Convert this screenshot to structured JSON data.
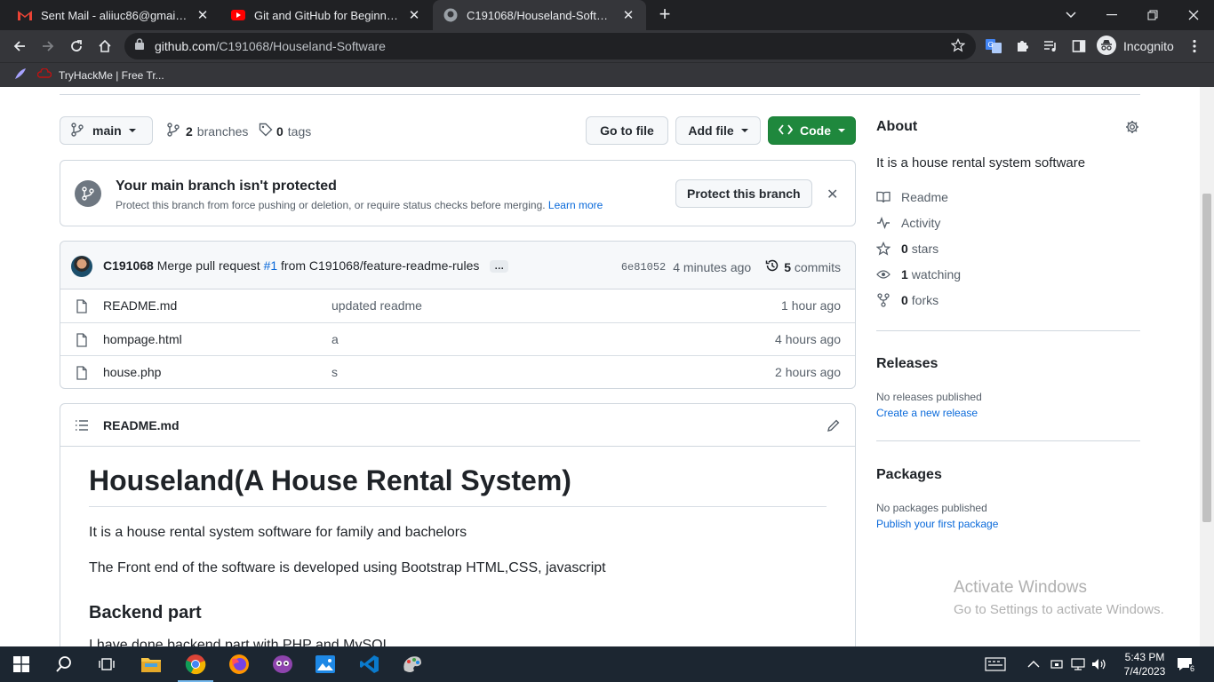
{
  "browser": {
    "tabs": [
      {
        "title": "Sent Mail - aliiuc86@gmail.com -",
        "icon": "gmail-icon"
      },
      {
        "title": "Git and GitHub for Beginners - Cr",
        "icon": "youtube-icon"
      },
      {
        "title": "C191068/Houseland-Software: It",
        "icon": "github-icon",
        "active": true
      }
    ],
    "url_host": "github.com",
    "url_path": "/C191068/Houseland-Software",
    "profile_label": "Incognito",
    "bookmark": "TryHackMe | Free Tr..."
  },
  "repo": {
    "branch": "main",
    "branches_count": "2",
    "branches_label": "branches",
    "tags_count": "0",
    "tags_label": "tags",
    "go_to_file": "Go to file",
    "add_file": "Add file",
    "code": "Code"
  },
  "protect": {
    "title": "Your main branch isn't protected",
    "desc": "Protect this branch from force pushing or deletion, or require status checks before merging.",
    "learn_more": "Learn more",
    "button": "Protect this branch"
  },
  "commit": {
    "author": "C191068",
    "message_pre": "Merge pull request",
    "pr": "#1",
    "message_post": "from C191068/feature-readme-rules",
    "more": "…",
    "sha": "6e81052",
    "time": "4 minutes ago",
    "count": "5",
    "count_label": "commits"
  },
  "files": [
    {
      "name": "README.md",
      "message": "updated readme",
      "age": "1 hour ago"
    },
    {
      "name": "hompage.html",
      "message": "a",
      "age": "4 hours ago"
    },
    {
      "name": "house.php",
      "message": "s",
      "age": "2 hours ago"
    }
  ],
  "readme": {
    "filename": "README.md",
    "h1": "Houseland(A House Rental System)",
    "p1": "It is a house rental system software for family and bachelors",
    "p2": "The Front end of the software is developed using Bootstrap HTML,CSS, javascript",
    "h2": "Backend part",
    "p3": "I have done backend part with PHP and MySQL"
  },
  "about": {
    "title": "About",
    "description": "It is a house rental system software",
    "readme": "Readme",
    "activity": "Activity",
    "stars_count": "0",
    "stars_label": "stars",
    "watching_count": "1",
    "watching_label": "watching",
    "forks_count": "0",
    "forks_label": "forks",
    "releases_title": "Releases",
    "releases_text": "No releases published",
    "releases_link": "Create a new release",
    "packages_title": "Packages",
    "packages_text": "No packages published",
    "packages_link": "Publish your first package"
  },
  "watermark": {
    "line1": "Activate Windows",
    "line2": "Go to Settings to activate Windows."
  },
  "taskbar": {
    "time": "5:43 PM",
    "date": "7/4/2023",
    "notifications": "6"
  },
  "colors": {
    "accent_green": "#1f883d",
    "link_blue": "#0969da",
    "chrome_dark": "#202124"
  }
}
